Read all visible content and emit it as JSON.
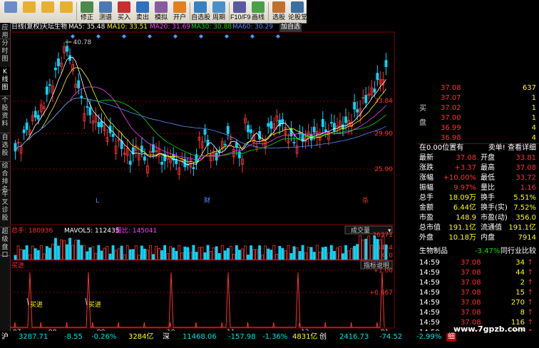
{
  "toolbar": {
    "buttons": [
      {
        "label": "",
        "icon": "home-icon"
      },
      {
        "label": "",
        "icon": "back-arrow-icon"
      },
      {
        "label": "",
        "icon": "up-arrow-icon"
      },
      {
        "label": "",
        "icon": "down-arrow-icon"
      },
      {
        "label": "修正",
        "icon": "edit-icon"
      },
      {
        "label": "测谱",
        "icon": "chart-icon"
      },
      {
        "label": "买入",
        "icon": "buy-icon"
      },
      {
        "label": "卖出",
        "icon": "sell-icon"
      },
      {
        "label": "模拟",
        "icon": "simulate-icon"
      },
      {
        "label": "开户",
        "icon": "open-account-icon"
      },
      {
        "label": "自选股",
        "icon": "watchlist-icon"
      },
      {
        "label": "周期",
        "icon": "period-icon"
      },
      {
        "label": "F10/F9",
        "icon": "f10-icon"
      },
      {
        "label": "画线",
        "icon": "draw-line-icon"
      },
      {
        "label": "选股",
        "icon": "stock-picker-icon"
      },
      {
        "label": "论股堂",
        "icon": "forum-icon"
      }
    ]
  },
  "sidetabs": [
    "应用",
    "分时图",
    "K线图",
    "个股资料",
    "自选股",
    "综合排名",
    "牛叉诊股",
    "超级盘口"
  ],
  "infobar": {
    "period": "日线(复权)",
    "stock": "天坛生物",
    "ma5": "MA5: 35.48",
    "ma10": "MA10: 33.51",
    "ma20": "MA20: 31.69",
    "ma30": "MA30: 30.88",
    "ma60": "MA60: 30.29",
    "extra": "加自选"
  },
  "price_axis": [
    "33.84",
    "29.90",
    "25.90"
  ],
  "peak_label": "40.78",
  "markers": [
    "L",
    "财",
    "杀"
  ],
  "volume": {
    "label1": "总手: 180936",
    "label2": "MAVOL5: 112435",
    "label3": "量比: 145041",
    "dropdown": "成交量",
    "axis_top": "26371",
    "axis_mid": "13434",
    "axis_unit": "X10"
  },
  "indicator": {
    "label": "买进",
    "help": "指标说明",
    "axis_top": "+1.00",
    "axis_mid": "+0.667",
    "signal": "买进"
  },
  "xaxis": [
    "07",
    "08",
    "09",
    "10",
    "11",
    "12",
    "01"
  ],
  "bottom_tabs": [
    "设置",
    "指标平台",
    "资讯",
    "DMI",
    "BIAS",
    "ASI",
    "VR",
    "ARBR",
    "DPO",
    "TRIX",
    "新DMA",
    "BBI",
    "MTM",
    "OBV",
    "SAR",
    "EXPMA",
    "能量2",
    "十战八胜3"
  ],
  "right_panel": {
    "asks": [
      {
        "price": "37.08",
        "vol": "637"
      },
      {
        "price": "37.07",
        "vol": "1"
      },
      {
        "price": "37.02",
        "vol": "1"
      },
      {
        "price": "37.00",
        "vol": "1"
      },
      {
        "price": "36.99",
        "vol": "4"
      },
      {
        "price": "36.98",
        "vol": "4"
      }
    ],
    "side_label_buy": "买",
    "side_label_pan": "盘",
    "status": "在0.00位置有",
    "status_right": "卖单! 查看详细",
    "stats": [
      [
        "最新",
        "37.08",
        "开盘",
        "33.81"
      ],
      [
        "涨跌",
        "+3.37",
        "最高",
        "37.08"
      ],
      [
        "涨幅",
        "+10.00%",
        "最低",
        "33.72"
      ],
      [
        "振幅",
        "9.97%",
        "量比",
        "1.16"
      ],
      [
        "总手",
        "18.09万",
        "换手",
        "5.51%"
      ],
      [
        "金额",
        "6.44亿",
        "换手(实)",
        "7.52%"
      ],
      [
        "市盈",
        "148.9",
        "市盈(动)",
        "356.0"
      ],
      [
        "总市值",
        "191.1亿",
        "流通值",
        "191.1亿"
      ],
      [
        "外盘",
        "10.18万",
        "内盘",
        "7914"
      ]
    ],
    "sector": "生物制品",
    "sector_pct": "-3.47%",
    "sector_right": "同行业比较",
    "ticks": [
      {
        "time": "14:59",
        "price": "37.08",
        "vol": "34"
      },
      {
        "time": "14:59",
        "price": "37.08",
        "vol": "44"
      },
      {
        "time": "14:59",
        "price": "37.08",
        "vol": "2"
      },
      {
        "time": "14:59",
        "price": "37.08",
        "vol": "15"
      },
      {
        "time": "14:59",
        "price": "37.08",
        "vol": "270"
      },
      {
        "time": "14:59",
        "price": "37.08",
        "vol": "8"
      },
      {
        "time": "14:59",
        "price": "37.08",
        "vol": "116"
      },
      {
        "time": "14:59",
        "price": "37.08",
        "vol": "202"
      },
      {
        "time": "14:59",
        "price": "37.08",
        "vol": "6"
      }
    ]
  },
  "market_bar": {
    "sh_label": "沪",
    "sh_index": "3287.71",
    "sh_change": "-8.55",
    "sh_pct": "-0.26%",
    "sh_amount": "3284亿",
    "sz_label": "深",
    "sz_index": "11468.06",
    "sz_change": "-157.98",
    "sz_pct": "-1.36%",
    "sz_amount": "4831亿",
    "cy_label": "创",
    "cy_index": "2416.73",
    "cy_change": "-74.52",
    "cy_pct": "-2.99%",
    "cy_tag": "细",
    "watermark": "www.7gpzb.com"
  },
  "colors": {
    "up": "#ff3030",
    "down": "#00d8ff",
    "ma5": "#ffffff",
    "ma10": "#ffff00",
    "ma20": "#ff40ff",
    "ma30": "#00e000",
    "ma60": "#5a8cff"
  }
}
